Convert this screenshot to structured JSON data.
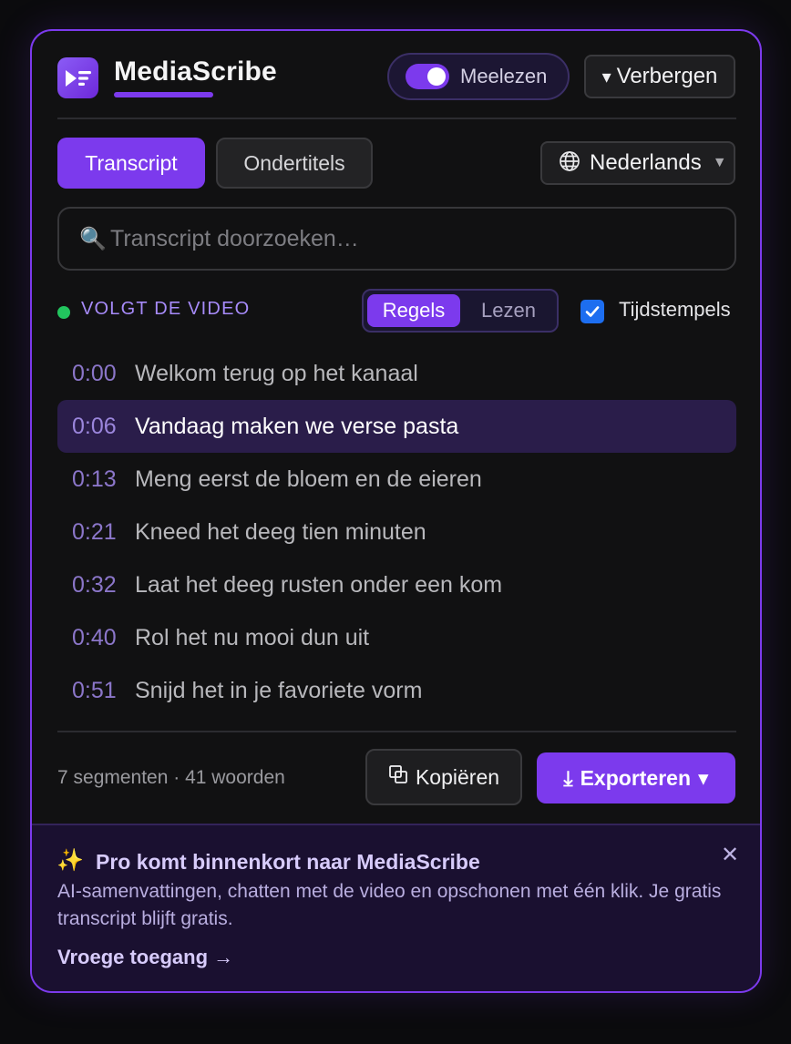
{
  "header": {
    "brand": "MediaScribe",
    "follow_label": "Meelezen",
    "follow_enabled": true,
    "hide_label": "Verbergen"
  },
  "tabs": [
    {
      "label": "Transcript",
      "active": true
    },
    {
      "label": "Ondertitels",
      "active": false
    }
  ],
  "language": {
    "selected": "Nederlands"
  },
  "search": {
    "placeholder": "Transcript doorzoeken…",
    "value": ""
  },
  "status": {
    "label": "VOLGT DE VIDEO"
  },
  "view_mode": {
    "options": [
      {
        "label": "Regels",
        "active": true
      },
      {
        "label": "Lezen",
        "active": false
      }
    ]
  },
  "timestamps": {
    "label": "Tijdstempels",
    "checked": true
  },
  "transcript": [
    {
      "time": "0:00",
      "text": "Welkom terug op het kanaal",
      "active": false
    },
    {
      "time": "0:06",
      "text": "Vandaag maken we verse pasta",
      "active": true
    },
    {
      "time": "0:13",
      "text": "Meng eerst de bloem en de eieren",
      "active": false
    },
    {
      "time": "0:21",
      "text": "Kneed het deeg tien minuten",
      "active": false
    },
    {
      "time": "0:32",
      "text": "Laat het deeg rusten onder een kom",
      "active": false
    },
    {
      "time": "0:40",
      "text": "Rol het nu mooi dun uit",
      "active": false
    },
    {
      "time": "0:51",
      "text": "Snijd het in je favoriete vorm",
      "active": false
    }
  ],
  "footer": {
    "counts": "7 segmenten · 41 woorden",
    "copy_label": "Kopiëren",
    "export_label": "Exporteren"
  },
  "promo": {
    "title": "Pro komt binnenkort naar MediaScribe",
    "body": "AI-samenvattingen, chatten met de video en opschonen met één klik. Je gratis transcript blijft gratis.",
    "link": "Vroege toegang"
  },
  "colors": {
    "accent": "#7c3aed",
    "status_dot": "#22c55e",
    "active_row": "#2a1d4a",
    "checkbox": "#1d6ef0"
  }
}
